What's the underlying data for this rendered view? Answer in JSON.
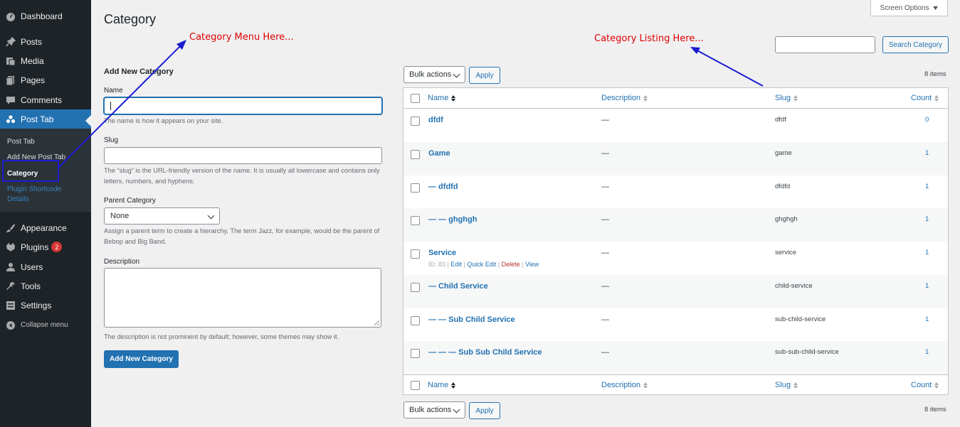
{
  "sidebar": {
    "items": [
      {
        "label": "Dashboard",
        "icon": "dashboard-icon"
      },
      {
        "label": "Posts",
        "icon": "pin-icon"
      },
      {
        "label": "Media",
        "icon": "media-icon"
      },
      {
        "label": "Pages",
        "icon": "pages-icon"
      },
      {
        "label": "Comments",
        "icon": "comments-icon"
      },
      {
        "label": "Post Tab",
        "icon": "groups-icon"
      },
      {
        "label": "Appearance",
        "icon": "brush-icon"
      },
      {
        "label": "Plugins",
        "icon": "plugin-icon",
        "badge": "2"
      },
      {
        "label": "Users",
        "icon": "users-icon"
      },
      {
        "label": "Tools",
        "icon": "wrench-icon"
      },
      {
        "label": "Settings",
        "icon": "settings-icon"
      }
    ],
    "submenu": {
      "post_tab": "Post Tab",
      "add_new": "Add New Post Tab",
      "category": "Category",
      "shortcode": "Plugin Shortcode Details"
    },
    "collapse": "Collapse menu"
  },
  "annotations": {
    "left_note": "Category Menu Here...",
    "right_note": "Category Listing Here..."
  },
  "page": {
    "title": "Category",
    "screen_options": "Screen Options"
  },
  "form": {
    "heading": "Add New Category",
    "name_label": "Name",
    "name_help": "The name is how it appears on your site.",
    "slug_label": "Slug",
    "slug_help": "The “slug” is the URL-friendly version of the name. It is usually all lowercase and contains only letters, numbers, and hyphens.",
    "parent_label": "Parent Category",
    "parent_value": "None",
    "parent_help": "Assign a parent term to create a hierarchy. The term Jazz, for example, would be the parent of Bebop and Big Band.",
    "desc_label": "Description",
    "desc_help": "The description is not prominent by default; however, some themes may show it.",
    "submit": "Add New Category"
  },
  "listing": {
    "search_button": "Search Category",
    "bulk_actions": "Bulk actions",
    "apply": "Apply",
    "items_count": "8 items",
    "columns": {
      "name": "Name",
      "description": "Description",
      "slug": "Slug",
      "count": "Count"
    },
    "rows": [
      {
        "name": "dfdf",
        "description": "—",
        "slug": "dfdf",
        "count": "0"
      },
      {
        "name": "Game",
        "description": "—",
        "slug": "game",
        "count": "1"
      },
      {
        "name": "— dfdfd",
        "description": "—",
        "slug": "dfdfd",
        "count": "1"
      },
      {
        "name": "— — ghghgh",
        "description": "—",
        "slug": "ghghgh",
        "count": "1"
      },
      {
        "name": "Service",
        "description": "—",
        "slug": "service",
        "count": "1"
      },
      {
        "name": "— Child Service",
        "description": "—",
        "slug": "child-service",
        "count": "1"
      },
      {
        "name": "— — Sub Child Service",
        "description": "—",
        "slug": "sub-child-service",
        "count": "1"
      },
      {
        "name": "— — — Sub Sub Child Service",
        "description": "—",
        "slug": "sub-sub-child-service",
        "count": "1"
      }
    ],
    "row_actions": {
      "id": "ID: 83",
      "edit": "Edit",
      "quick_edit": "Quick Edit",
      "delete": "Delete",
      "view": "View"
    }
  },
  "colors": {
    "accent": "#2271b1",
    "sidebar": "#1d2327",
    "annotation": "#e00000",
    "annotation_line": "#1b1bd0"
  }
}
